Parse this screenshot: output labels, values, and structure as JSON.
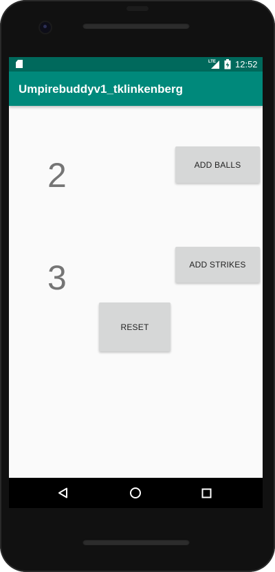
{
  "status_bar": {
    "time": "12:52",
    "icons": [
      "sd-card-icon",
      "lte-signal-icon",
      "battery-charging-icon"
    ]
  },
  "app_bar": {
    "title": "Umpirebuddyv1_tklinkenberg",
    "color": "#00897b",
    "status_color": "#00695c"
  },
  "counters": {
    "balls": "2",
    "strikes": "3"
  },
  "buttons": {
    "add_balls": "ADD BALLS",
    "add_strikes": "ADD STRIKES",
    "reset": "RESET"
  },
  "nav_bar": {
    "icons": [
      "back-icon",
      "home-icon",
      "recents-icon"
    ]
  }
}
